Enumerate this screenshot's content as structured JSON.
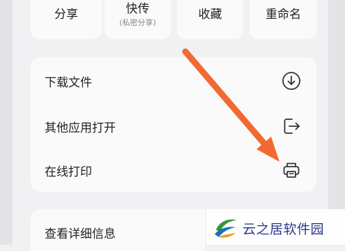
{
  "quick_actions": [
    {
      "label": "分享",
      "sub": ""
    },
    {
      "label": "快传",
      "sub": "(私密分享)"
    },
    {
      "label": "收藏",
      "sub": ""
    },
    {
      "label": "重命名",
      "sub": ""
    }
  ],
  "menu": {
    "items": [
      {
        "label": "下载文件",
        "icon": "download-icon"
      },
      {
        "label": "其他应用打开",
        "icon": "open-external-icon"
      },
      {
        "label": "在线打印",
        "icon": "printer-icon"
      }
    ]
  },
  "secondary": {
    "label": "查看详细信息"
  },
  "annotation": {
    "arrow_color": "#f26a32"
  },
  "watermark": {
    "text": "云之居软件园"
  }
}
